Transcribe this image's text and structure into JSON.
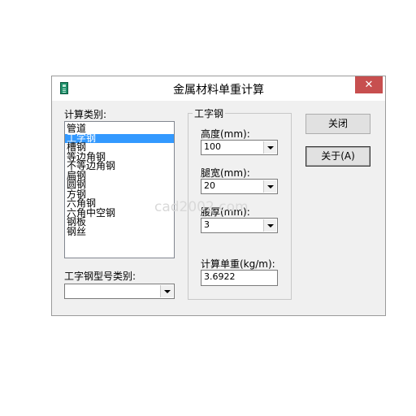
{
  "window": {
    "title": "金属材料单重计算",
    "close_glyph": "✕",
    "icon": "calculator-app-icon"
  },
  "left": {
    "category_label": "计算类别:",
    "categories": [
      "管道",
      "工字钢",
      "槽钢",
      "等边角钢",
      "不等边角钢",
      "扁钢",
      "圆钢",
      "方钢",
      "六角钢",
      "六角中空钢",
      "钢板",
      "钢丝"
    ],
    "selected_index": 1,
    "type_label": "工字钢型号类别:",
    "type_value": ""
  },
  "group": {
    "title": "工字钢",
    "height_label": "高度(mm):",
    "height_value": "100",
    "leg_width_label": "腿宽(mm):",
    "leg_width_value": "20",
    "waist_thickness_label": "腰厚(mm):",
    "waist_thickness_value": "3",
    "unit_weight_label": "计算单重(kg/m):",
    "unit_weight_value": "3.6922"
  },
  "buttons": {
    "close_label": "关闭",
    "about_label": "关于(A)"
  },
  "watermark": "cad2002.com",
  "colors": {
    "selection": "#3399ff",
    "close_button": "#c74f4f",
    "window_bg": "#f0f0f0"
  }
}
